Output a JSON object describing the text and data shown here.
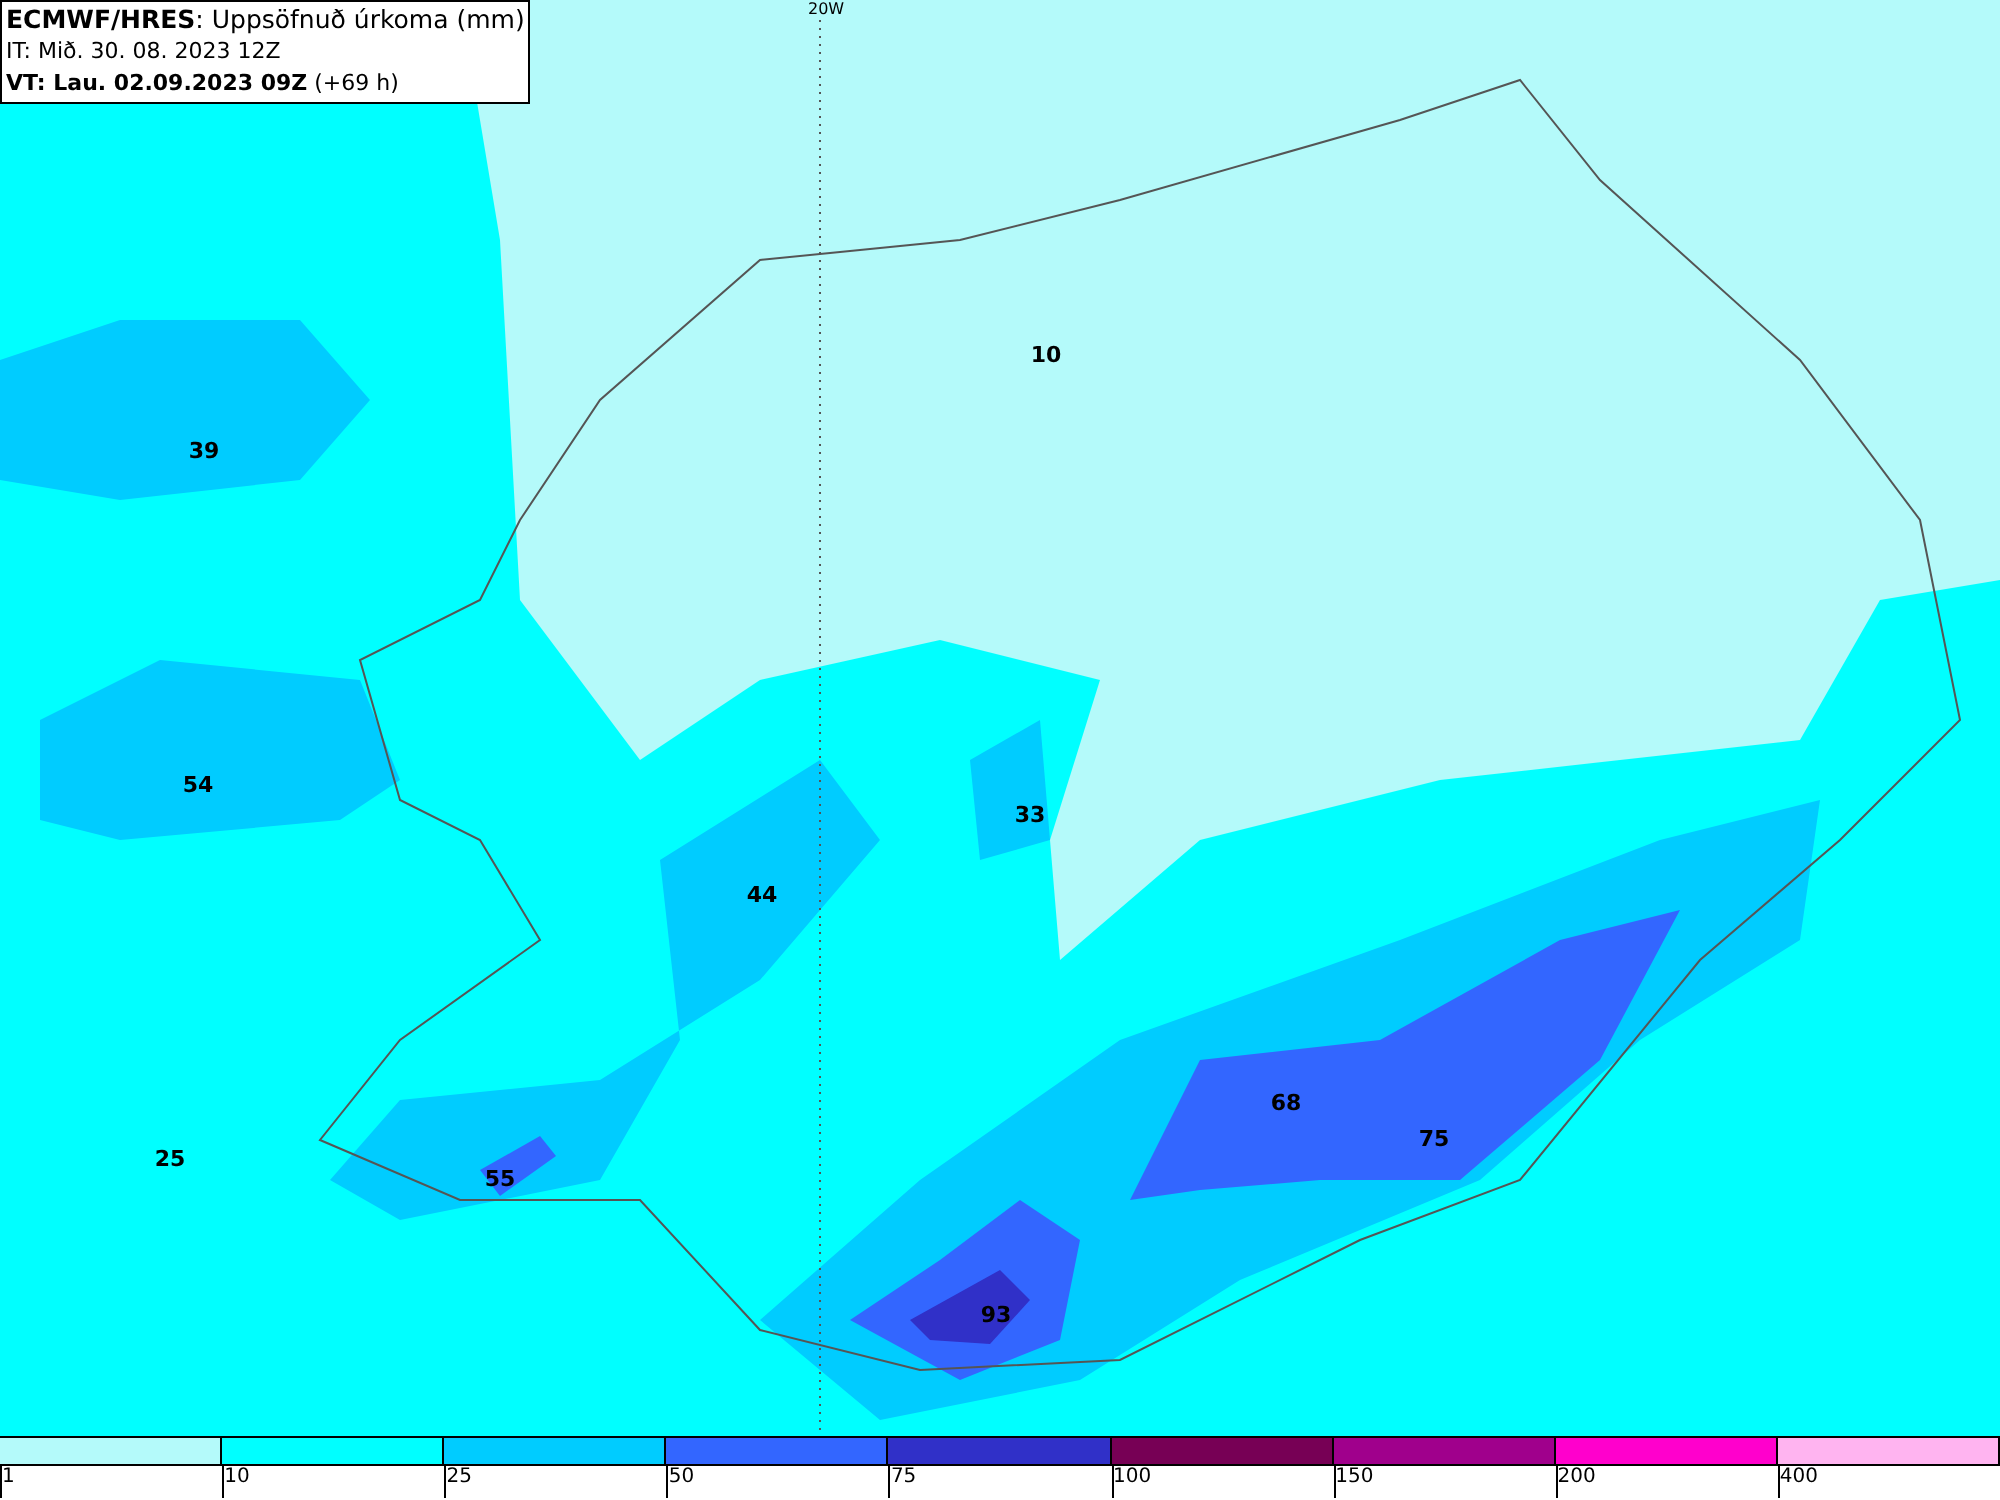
{
  "header": {
    "title": "**ECMWF/HRES**: Uppsöfnuð úrkoma (mm)",
    "issue_time": "IT: Mið. 30. 08. 2023 12Z",
    "valid_time": "**VT: Lau. 02.09.2023 09Z** (+69 h)"
  },
  "map": {
    "meridian_label": "20W",
    "values": [
      "10",
      "39",
      "54",
      "33",
      "44",
      "25",
      "55",
      "68",
      "75",
      "93"
    ]
  },
  "legend": {
    "bins": [
      {
        "color": "#b4fafa"
      },
      {
        "color": "#00ffff"
      },
      {
        "color": "#00ccff"
      },
      {
        "color": "#3366ff"
      },
      {
        "color": "#3030c8"
      },
      {
        "color": "#770055"
      },
      {
        "color": "#a0008c"
      },
      {
        "color": "#ff00cc"
      },
      {
        "color": "#ffb4f0"
      }
    ],
    "ticks": [
      "1",
      "10",
      "25",
      "50",
      "75",
      "100",
      "150",
      "200",
      "400"
    ]
  }
}
